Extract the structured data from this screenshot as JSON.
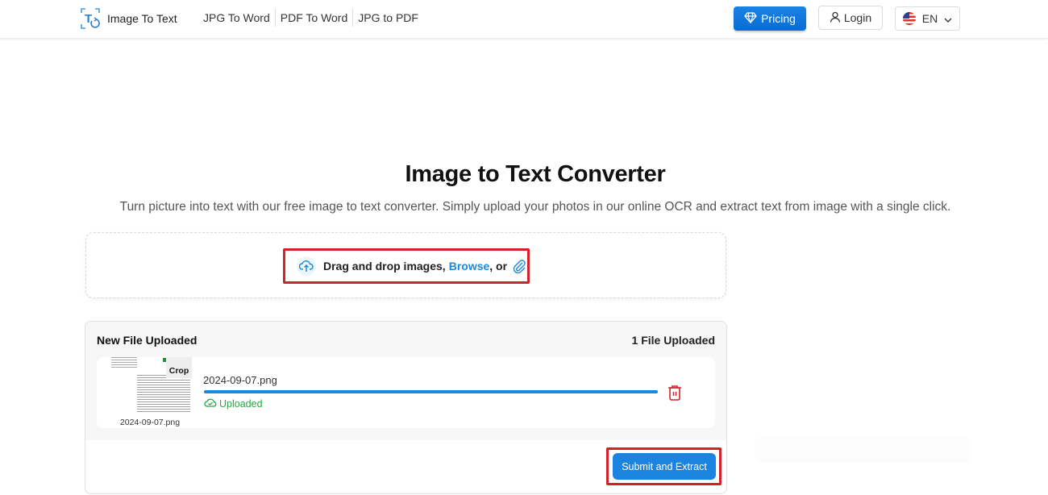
{
  "header": {
    "logo_text": "Image To Text",
    "nav": [
      "JPG To Word",
      "PDF To Word",
      "JPG to PDF"
    ],
    "pricing_label": "Pricing",
    "login_label": "Login",
    "language_label": "EN"
  },
  "hero": {
    "title": "Image to Text Converter",
    "subtitle": "Turn picture into text with our free image to text converter. Simply upload your photos in our online OCR and extract text from image with a single click."
  },
  "dropzone": {
    "text": "Drag and drop images,",
    "browse_label": "Browse",
    "or_text": ", or"
  },
  "upload_panel": {
    "title": "New File Uploaded",
    "count_label": "1 File Uploaded",
    "files": [
      {
        "thumbnail_name": "2024-09-07.png",
        "crop_label": "Crop",
        "name": "2024-09-07.png",
        "progress_percent": 100,
        "status": "Uploaded"
      }
    ],
    "submit_label": "Submit and Extract"
  },
  "colors": {
    "accent": "#1a84e0",
    "success": "#28a745",
    "danger": "#d4202a",
    "highlight_box": "#d4202a"
  }
}
